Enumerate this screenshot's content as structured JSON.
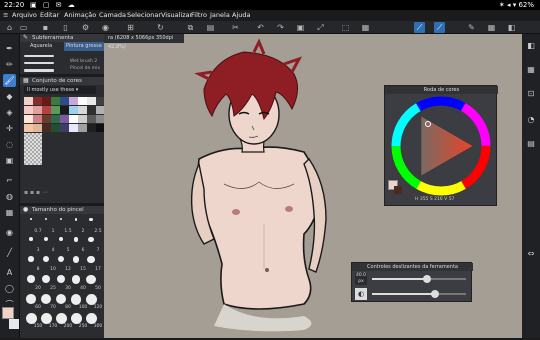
{
  "status": {
    "time": "22:20",
    "battery": "62%"
  },
  "menu": [
    "Arquivo",
    "Editar",
    "Animação",
    "Camada",
    "Selecionar",
    "Visualizar",
    "Filtro",
    "Janela",
    "Ajuda"
  ],
  "doc_tab": "ra (6208 x 5066px 350dpi 42.8%)",
  "subtool": {
    "title": "Subferramenta",
    "tabs": [
      "Aquarela",
      "Pintura grossa"
    ],
    "brushes": [
      "",
      "Wet brush 2",
      "Pincel de mix"
    ]
  },
  "colorset": {
    "title": "Conjunto de cores",
    "dropdown": "Il mostly use these",
    "colors": [
      [
        "#f0d2c8",
        "#8b2a2a",
        "#6b1818",
        "#3a7a3a",
        "#2d4d8a",
        "#c7a7d6",
        "#ffffff",
        "#e8e8e8",
        "#404040"
      ],
      [
        "#f7c8c8",
        "#e0a0a0",
        "#b74040",
        "#5c9a5c",
        "#1a1a1a",
        "#9ad1f0",
        "#d8d8d8",
        "#303030",
        "#b0b0b0"
      ],
      [
        "#ffe6d8",
        "#d08080",
        "#6e3a2e",
        "#2e6b4a",
        "#7b5aa6",
        "#ffffff",
        "#cfcfcf",
        "#5a5a5a",
        "#8a8a8a"
      ],
      [
        "#f4c6a8",
        "#e3b59a",
        "#4a2a20",
        "#205030",
        "#3d3d6a",
        "#e7e7ff",
        "#a0a0a0",
        "#202020",
        "#101010"
      ]
    ]
  },
  "brushsize": {
    "title": "Tamanho do pincel",
    "sizes": [
      "0.7",
      "1",
      "1.5",
      "2",
      "2.5",
      "3",
      "4",
      "5",
      "6",
      "7",
      "8",
      "10",
      "12",
      "15",
      "17",
      "20",
      "25",
      "30",
      "40",
      "50",
      "60",
      "70",
      "80",
      "100",
      "120",
      "150",
      "170",
      "200",
      "250",
      "300"
    ]
  },
  "colorwheel": {
    "title": "Roda de cores",
    "h": "355",
    "s": "216",
    "v": "57"
  },
  "toolprop": {
    "title": "Controles deslizantes da ferramenta",
    "size": "40.0",
    "size_unit": "px",
    "opacity_label": ""
  },
  "colors": {
    "accent": "#2f6db5",
    "main_color": "#f0d2c8",
    "sub_color": "#4a2a20",
    "canvas_bg": "#a49e94"
  }
}
